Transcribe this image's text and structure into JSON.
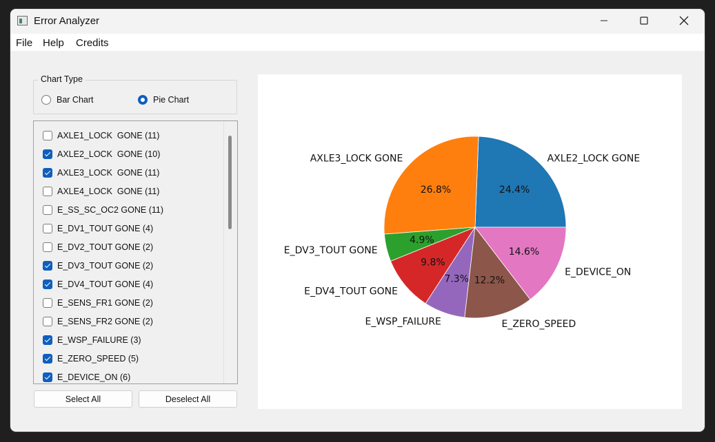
{
  "window": {
    "title": "Error Analyzer",
    "controls": {
      "minimize": "minimize-icon",
      "maximize": "maximize-icon",
      "close": "close-icon"
    }
  },
  "menu": {
    "items": [
      "File",
      "Help",
      "Credits"
    ]
  },
  "chart_type": {
    "group_title": "Chart Type",
    "options": [
      {
        "label": "Bar Chart",
        "selected": false
      },
      {
        "label": "Pie Chart",
        "selected": true
      }
    ]
  },
  "error_list": {
    "items": [
      {
        "label": "AXLE1_LOCK  GONE (11)",
        "checked": false
      },
      {
        "label": "AXLE2_LOCK  GONE (10)",
        "checked": true
      },
      {
        "label": "AXLE3_LOCK  GONE (11)",
        "checked": true
      },
      {
        "label": "AXLE4_LOCK  GONE (11)",
        "checked": false
      },
      {
        "label": "E_SS_SC_OC2 GONE (11)",
        "checked": false
      },
      {
        "label": "E_DV1_TOUT GONE (4)",
        "checked": false
      },
      {
        "label": "E_DV2_TOUT GONE (2)",
        "checked": false
      },
      {
        "label": "E_DV3_TOUT GONE (2)",
        "checked": true
      },
      {
        "label": "E_DV4_TOUT GONE (4)",
        "checked": true
      },
      {
        "label": "E_SENS_FR1 GONE (2)",
        "checked": false
      },
      {
        "label": "E_SENS_FR2 GONE (2)",
        "checked": false
      },
      {
        "label": "E_WSP_FAILURE (3)",
        "checked": true
      },
      {
        "label": "E_ZERO_SPEED (5)",
        "checked": true
      },
      {
        "label": "E_DEVICE_ON (6)",
        "checked": true
      }
    ]
  },
  "buttons": {
    "select_all": "Select All",
    "deselect_all": "Deselect All"
  },
  "colors": {
    "accent": "#0f5fbd"
  },
  "chart_data": {
    "type": "pie",
    "title": "",
    "slices": [
      {
        "label": "AXLE2_LOCK  GONE",
        "value": 10,
        "pct_label": "24.4%",
        "color": "#1f77b4"
      },
      {
        "label": "AXLE3_LOCK  GONE",
        "value": 11,
        "pct_label": "26.8%",
        "color": "#ff7f0e"
      },
      {
        "label": "E_DV3_TOUT GONE",
        "value": 2,
        "pct_label": "4.9%",
        "color": "#2ca02c"
      },
      {
        "label": "E_DV4_TOUT GONE",
        "value": 4,
        "pct_label": "9.8%",
        "color": "#d62728"
      },
      {
        "label": "E_WSP_FAILURE",
        "value": 3,
        "pct_label": "7.3%",
        "color": "#9467bd"
      },
      {
        "label": "E_ZERO_SPEED",
        "value": 5,
        "pct_label": "12.2%",
        "color": "#8c564b"
      },
      {
        "label": "E_DEVICE_ON",
        "value": 6,
        "pct_label": "14.6%",
        "color": "#e377c2"
      }
    ],
    "start_angle_deg": 0,
    "direction": "counterclockwise"
  }
}
